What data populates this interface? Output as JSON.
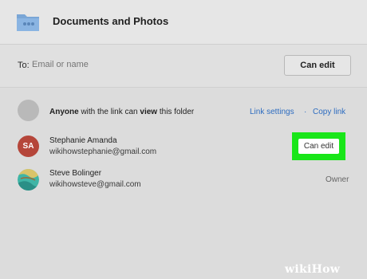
{
  "dialog": {
    "title": "Documents and Photos",
    "folder_icon": "shared-folder-icon",
    "to_label": "To:",
    "to_placeholder": "Email or name",
    "permission_button": "Can edit"
  },
  "link_access": {
    "text_prefix": "Anyone",
    "text_middle": " with the link can ",
    "text_bold": "view",
    "text_suffix": " this folder",
    "link_settings": "Link settings",
    "separator": "·",
    "copy_link": "Copy link"
  },
  "members": [
    {
      "initials": "SA",
      "name": "Stephanie Amanda",
      "email": "wikihowstephanie@gmail.com",
      "role": "Can edit",
      "avatar_color": "#b5463a"
    },
    {
      "initials": "",
      "name": "Steve Bolinger",
      "email": "wikihowsteve@gmail.com",
      "role": "Owner"
    }
  ],
  "colors": {
    "link_blue": "#2d6cc0",
    "highlight_green": "#19e619"
  },
  "watermark": "wikiHow"
}
